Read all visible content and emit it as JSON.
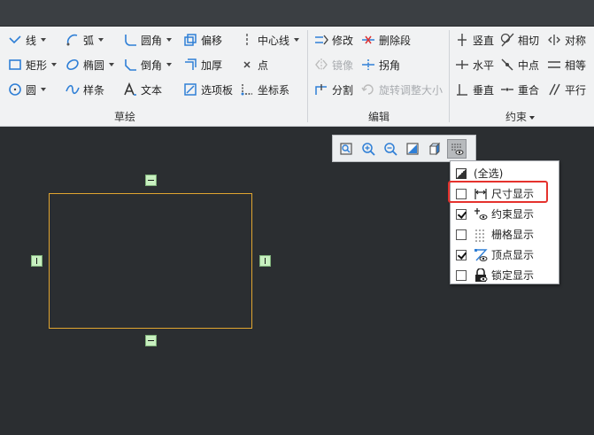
{
  "ribbon": {
    "groups": {
      "sketch": "草绘",
      "edit": "编辑",
      "constraint": "约束"
    },
    "sketch_tools": {
      "line": "线",
      "arc": "弧",
      "fillet": "圆角",
      "offset": "偏移",
      "centerline": "中心线",
      "rectangle": "矩形",
      "ellipse": "椭圆",
      "chamfer": "倒角",
      "thicken": "加厚",
      "point": "点",
      "circle": "圆",
      "spline": "样条",
      "text": "文本",
      "palette": "选项板",
      "coordsys": "坐标系"
    },
    "edit_tools": {
      "modify": "修改",
      "delete_segment": "删除段",
      "mirror": "镜像",
      "corner": "拐角",
      "divide": "分割",
      "rotate_resize": "旋转调整大小"
    },
    "constraint_tools": {
      "vertical": "竖直",
      "tangent": "相切",
      "symmetric": "对称",
      "horizontal": "水平",
      "midpoint": "中点",
      "equal": "相等",
      "perpendicular": "垂直",
      "coincident": "重合",
      "parallel": "平行"
    }
  },
  "display_menu": {
    "items": [
      {
        "label": "(全选)",
        "state": "partial",
        "icon": "select-all-icon"
      },
      {
        "label": "尺寸显示",
        "state": "unchecked",
        "icon": "dimension-icon"
      },
      {
        "label": "约束显示",
        "state": "checked",
        "icon": "constraint-icon"
      },
      {
        "label": "栅格显示",
        "state": "unchecked",
        "icon": "grid-icon"
      },
      {
        "label": "顶点显示",
        "state": "checked",
        "icon": "vertex-icon"
      },
      {
        "label": "锁定显示",
        "state": "unchecked",
        "icon": "lock-icon"
      }
    ]
  },
  "colors": {
    "canvas": "#2b2e31",
    "sketch_line": "#e0a530",
    "constraint_marker": "#c8f0c0",
    "highlight": "#e5322d",
    "ribbon_icon_blue": "#2f7fd6"
  }
}
